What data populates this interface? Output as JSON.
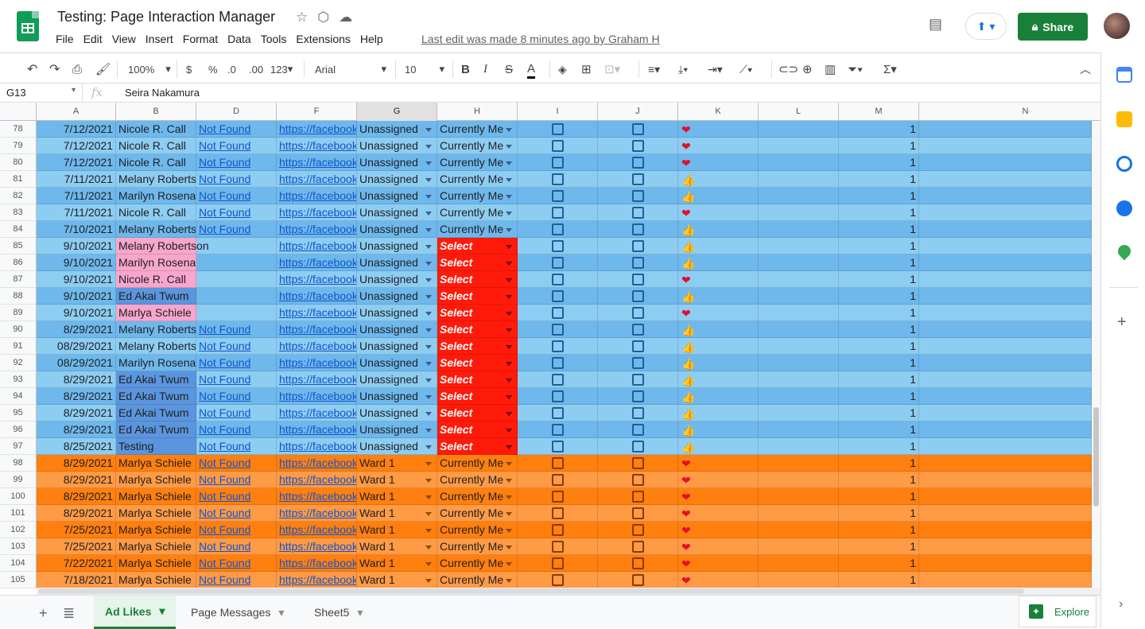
{
  "app": {
    "title": "Testing: Page Interaction Manager",
    "last_edit": "Last edit was made 8 minutes ago by Graham H",
    "share_label": "Share",
    "brand_color": "#188038"
  },
  "menu": [
    "File",
    "Edit",
    "View",
    "Insert",
    "Format",
    "Data",
    "Tools",
    "Extensions",
    "Help"
  ],
  "toolbar": {
    "zoom": "100%",
    "currency": "$",
    "percent": "%",
    "dec_less": ".0",
    "dec_more": ".00",
    "format": "123",
    "font": "Arial",
    "font_size": "10"
  },
  "formula": {
    "cell_ref": "G13",
    "fx": "fx",
    "content": "Seira Nakamura"
  },
  "columns": [
    "A",
    "B",
    "D",
    "F",
    "G",
    "H",
    "I",
    "J",
    "K",
    "L",
    "M",
    "N"
  ],
  "rows": [
    {
      "n": "78",
      "a": "7/12/2021",
      "b": "Nicole R. Call",
      "d": "Not Found",
      "f": "https://facebook.",
      "g": "Unassigned",
      "h": "Currently Me",
      "k": "heart",
      "m": "1",
      "scheme": "blue1"
    },
    {
      "n": "79",
      "a": "7/12/2021",
      "b": "Nicole R. Call",
      "d": "Not Found",
      "f": "https://facebook.",
      "g": "Unassigned",
      "h": "Currently Me",
      "k": "heart",
      "m": "1",
      "scheme": "blue2"
    },
    {
      "n": "80",
      "a": "7/12/2021",
      "b": "Nicole R. Call",
      "d": "Not Found",
      "f": "https://facebook.",
      "g": "Unassigned",
      "h": "Currently Me",
      "k": "heart",
      "m": "1",
      "scheme": "blue1"
    },
    {
      "n": "81",
      "a": "7/11/2021",
      "b": "Melany Robertso",
      "d": "Not Found",
      "f": "https://facebook.",
      "g": "Unassigned",
      "h": "Currently Me",
      "k": "thumb",
      "m": "1",
      "scheme": "blue2"
    },
    {
      "n": "82",
      "a": "7/11/2021",
      "b": "Marilyn Rosenau",
      "d": "Not Found",
      "f": "https://facebook.",
      "g": "Unassigned",
      "h": "Currently Me",
      "k": "thumb",
      "m": "1",
      "scheme": "blue1"
    },
    {
      "n": "83",
      "a": "7/11/2021",
      "b": "Nicole R. Call",
      "d": "Not Found",
      "f": "https://facebook.",
      "g": "Unassigned",
      "h": "Currently Me",
      "k": "heart",
      "m": "1",
      "scheme": "blue2"
    },
    {
      "n": "84",
      "a": "7/10/2021",
      "b": "Melany Robertso",
      "d": "Not Found",
      "f": "https://facebook.",
      "g": "Unassigned",
      "h": "Currently Me",
      "k": "thumb",
      "m": "1",
      "scheme": "blue1"
    },
    {
      "n": "85",
      "a": "9/10/2021",
      "b": "Melany Robertson",
      "d": "",
      "f": "https://facebook.",
      "g": "Unassigned",
      "h": "Select",
      "k": "thumb",
      "m": "1",
      "scheme": "blue2",
      "bcolor": "pink"
    },
    {
      "n": "86",
      "a": "9/10/2021",
      "b": "Marilyn Rosenau",
      "d": "",
      "f": "https://facebook.",
      "g": "Unassigned",
      "h": "Select",
      "k": "thumb",
      "m": "1",
      "scheme": "blue1",
      "bcolor": "pink"
    },
    {
      "n": "87",
      "a": "9/10/2021",
      "b": "Nicole R. Call",
      "d": "",
      "f": "https://facebook.",
      "g": "Unassigned",
      "h": "Select",
      "k": "heart",
      "m": "1",
      "scheme": "blue2",
      "bcolor": "pink"
    },
    {
      "n": "88",
      "a": "9/10/2021",
      "b": "Ed Akai Twum",
      "d": "",
      "f": "https://facebook.",
      "g": "Unassigned",
      "h": "Select",
      "k": "thumb",
      "m": "1",
      "scheme": "blue1",
      "bcolor": "dblue"
    },
    {
      "n": "89",
      "a": "9/10/2021",
      "b": "Marlya Schiele",
      "d": "",
      "f": "https://facebook.",
      "g": "Unassigned",
      "h": "Select",
      "k": "heart",
      "m": "1",
      "scheme": "blue2",
      "bcolor": "pink"
    },
    {
      "n": "90",
      "a": "8/29/2021",
      "b": "Melany Robertso",
      "d": "Not Found",
      "f": "https://facebook.",
      "g": "Unassigned",
      "h": "Select",
      "k": "thumb",
      "m": "1",
      "scheme": "blue1"
    },
    {
      "n": "91",
      "a": "08/29/2021",
      "b": "Melany Robertso",
      "d": "Not Found",
      "f": "https://facebook.",
      "g": "Unassigned",
      "h": "Select",
      "k": "thumb",
      "m": "1",
      "scheme": "blue2"
    },
    {
      "n": "92",
      "a": "08/29/2021",
      "b": "Marilyn Rosenau",
      "d": "Not Found",
      "f": "https://facebook.",
      "g": "Unassigned",
      "h": "Select",
      "k": "thumb",
      "m": "1",
      "scheme": "blue1"
    },
    {
      "n": "93",
      "a": "8/29/2021",
      "b": "Ed Akai Twum",
      "d": "Not Found",
      "f": "https://facebook.",
      "g": "Unassigned",
      "h": "Select",
      "k": "thumb",
      "m": "1",
      "scheme": "blue2",
      "bcolor": "dblue"
    },
    {
      "n": "94",
      "a": "8/29/2021",
      "b": "Ed Akai Twum",
      "d": "Not Found",
      "f": "https://facebook.",
      "g": "Unassigned",
      "h": "Select",
      "k": "thumb",
      "m": "1",
      "scheme": "blue1",
      "bcolor": "dblue"
    },
    {
      "n": "95",
      "a": "8/29/2021",
      "b": "Ed Akai Twum",
      "d": "Not Found",
      "f": "https://facebook.",
      "g": "Unassigned",
      "h": "Select",
      "k": "thumb",
      "m": "1",
      "scheme": "blue2",
      "bcolor": "dblue"
    },
    {
      "n": "96",
      "a": "8/29/2021",
      "b": "Ed Akai Twum",
      "d": "Not Found",
      "f": "https://facebook.",
      "g": "Unassigned",
      "h": "Select",
      "k": "thumb",
      "m": "1",
      "scheme": "blue1",
      "bcolor": "dblue"
    },
    {
      "n": "97",
      "a": "8/25/2021",
      "b": "Testing",
      "d": "Not Found",
      "f": "https://facebook.",
      "g": "Unassigned",
      "h": "Select",
      "k": "thumb",
      "m": "1",
      "scheme": "blue2",
      "bcolor": "dblue"
    },
    {
      "n": "98",
      "a": "8/29/2021",
      "b": "Marlya Schiele",
      "d": "Not Found",
      "f": "https://facebook.",
      "g": "Ward 1",
      "h": "Currently Me",
      "k": "heart",
      "m": "1",
      "scheme": "or1"
    },
    {
      "n": "99",
      "a": "8/29/2021",
      "b": "Marlya Schiele",
      "d": "Not Found",
      "f": "https://facebook.",
      "g": "Ward 1",
      "h": "Currently Me",
      "k": "heart",
      "m": "1",
      "scheme": "or2"
    },
    {
      "n": "100",
      "a": "8/29/2021",
      "b": "Marlya Schiele",
      "d": "Not Found",
      "f": "https://facebook.",
      "g": "Ward 1",
      "h": "Currently Me",
      "k": "heart",
      "m": "1",
      "scheme": "or1"
    },
    {
      "n": "101",
      "a": "8/29/2021",
      "b": "Marlya Schiele",
      "d": "Not Found",
      "f": "https://facebook.",
      "g": "Ward 1",
      "h": "Currently Me",
      "k": "heart",
      "m": "1",
      "scheme": "or2"
    },
    {
      "n": "102",
      "a": "7/25/2021",
      "b": "Marlya Schiele",
      "d": "Not Found",
      "f": "https://facebook.",
      "g": "Ward 1",
      "h": "Currently Me",
      "k": "heart",
      "m": "1",
      "scheme": "or1"
    },
    {
      "n": "103",
      "a": "7/25/2021",
      "b": "Marlya Schiele",
      "d": "Not Found",
      "f": "https://facebook.",
      "g": "Ward 1",
      "h": "Currently Me",
      "k": "heart",
      "m": "1",
      "scheme": "or2"
    },
    {
      "n": "104",
      "a": "7/22/2021",
      "b": "Marlya Schiele",
      "d": "Not Found",
      "f": "https://facebook.",
      "g": "Ward 1",
      "h": "Currently Me",
      "k": "heart",
      "m": "1",
      "scheme": "or1"
    },
    {
      "n": "105",
      "a": "7/18/2021",
      "b": "Marlya Schiele",
      "d": "Not Found",
      "f": "https://facebook.",
      "g": "Ward 1",
      "h": "Currently Me",
      "k": "heart",
      "m": "1",
      "scheme": "or2"
    }
  ],
  "colors": {
    "blue1": "#6fb8ec",
    "blue2": "#8ecdf2",
    "or1": "#ff7f0f",
    "or2": "#ff9a45",
    "pink": "#f8a6cb",
    "dblue": "#5b95de",
    "select_red": "#ff1a0a"
  },
  "icons": {
    "heart": "❤",
    "thumb": "👍"
  },
  "sheets": {
    "active": "Ad Likes",
    "others": [
      "Page Messages",
      "Sheet5"
    ],
    "explore": "Explore"
  }
}
